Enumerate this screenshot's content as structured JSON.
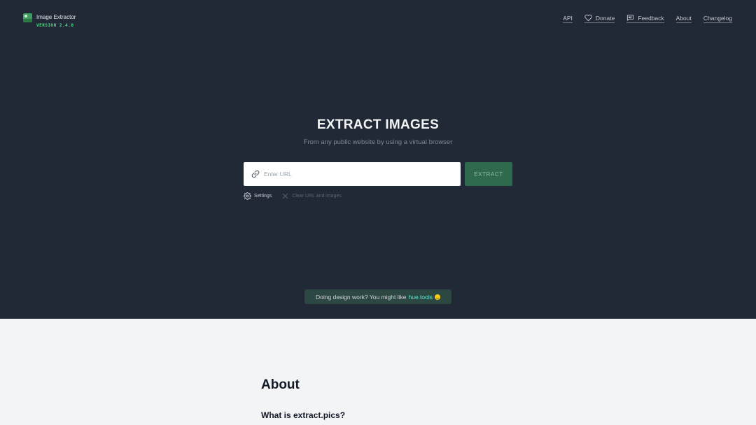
{
  "brand": {
    "name": "Image Extractor",
    "version": "VERSION 2.4.0"
  },
  "nav": {
    "api": "API",
    "donate": "Donate",
    "feedback": "Feedback",
    "about": "About",
    "changelog": "Changelog"
  },
  "hero": {
    "title": "EXTRACT IMAGES",
    "subtitle": "From any public website by using a virtual browser"
  },
  "form": {
    "url_value": "",
    "url_placeholder": "Enter URL",
    "extract_label": "EXTRACT",
    "settings_label": "Settings",
    "clear_label": "Clear URL and images"
  },
  "promo": {
    "text": "Doing design work? You might like",
    "link_label": "hue.tools"
  },
  "about": {
    "heading": "About",
    "question": "What is extract.pics?"
  },
  "icons": {
    "logo": "image-icon",
    "donate": "heart-icon",
    "feedback": "chat-icon",
    "url": "link-icon",
    "settings": "gear-icon",
    "clear": "close-icon",
    "emoji": "smiley-icon"
  },
  "colors": {
    "hero_bg": "#222936",
    "accent_green": "#2f6a4f",
    "version_green": "#4ade80",
    "promo_link": "#5eead4",
    "page_bg": "#f3f4f6"
  }
}
